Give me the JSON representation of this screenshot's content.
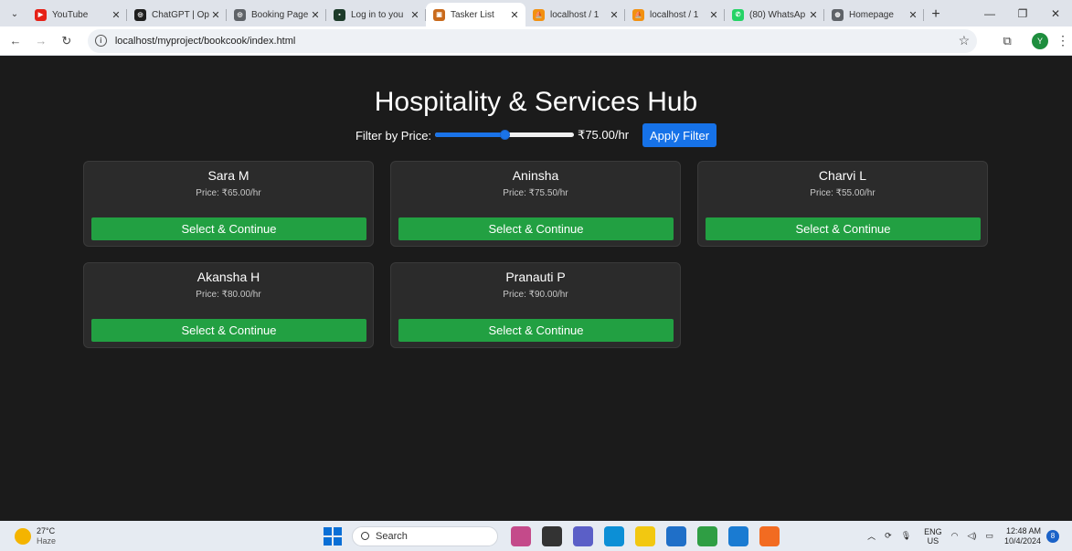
{
  "browser": {
    "tabs": [
      {
        "title": "YouTube",
        "color": "#e62117",
        "glyph": "▶",
        "active": false
      },
      {
        "title": "ChatGPT | Op",
        "color": "#1f1f1f",
        "glyph": "◎",
        "active": false
      },
      {
        "title": "Booking Page",
        "color": "#5f6368",
        "glyph": "◎",
        "active": false
      },
      {
        "title": "Log in to you",
        "color": "#1d3b2a",
        "glyph": "▪",
        "active": false
      },
      {
        "title": "Tasker List",
        "color": "#c96a1b",
        "glyph": "▣",
        "active": true
      },
      {
        "title": "localhost / 1",
        "color": "#f29111",
        "glyph": "⛵",
        "active": false
      },
      {
        "title": "localhost / 1",
        "color": "#f29111",
        "glyph": "⛵",
        "active": false
      },
      {
        "title": "(80) WhatsAp",
        "color": "#25d366",
        "glyph": "✆",
        "active": false
      },
      {
        "title": "Homepage",
        "color": "#5f6368",
        "glyph": "◍",
        "active": false
      }
    ],
    "url": "localhost/myproject/bookcook/index.html",
    "profile_initial": "Y"
  },
  "page": {
    "title": "Hospitality & Services Hub",
    "filter_label": "Filter by Price:",
    "price_value": "₹75.00/hr",
    "slider_fraction": 0.5,
    "apply_label": "Apply Filter",
    "select_label": "Select & Continue",
    "taskers": [
      {
        "name": "Sara M",
        "price": "Price: ₹65.00/hr"
      },
      {
        "name": "Aninsha",
        "price": "Price: ₹75.50/hr"
      },
      {
        "name": "Charvi L",
        "price": "Price: ₹55.00/hr"
      },
      {
        "name": "Akansha H",
        "price": "Price: ₹80.00/hr"
      },
      {
        "name": "Pranauti P",
        "price": "Price: ₹90.00/hr"
      }
    ]
  },
  "taskbar": {
    "temperature": "27°C",
    "condition": "Haze",
    "search_placeholder": "Search",
    "apps": [
      {
        "name": "landscape-app-icon",
        "color": "#c44a8a"
      },
      {
        "name": "terminal-icon",
        "color": "#333333"
      },
      {
        "name": "meet-icon",
        "color": "#5b5fc7"
      },
      {
        "name": "edge-icon",
        "color": "#0c8fd6"
      },
      {
        "name": "file-explorer-icon",
        "color": "#f2c811"
      },
      {
        "name": "mail-icon",
        "color": "#1f6fc8"
      },
      {
        "name": "chrome-icon",
        "color": "#2f9e44"
      },
      {
        "name": "vscode-icon",
        "color": "#1a7bd2"
      },
      {
        "name": "xampp-icon",
        "color": "#f26b21"
      }
    ],
    "lang_top": "ENG",
    "lang_bottom": "US",
    "time": "12:48 AM",
    "date": "10/4/2024",
    "notifications": "8"
  }
}
